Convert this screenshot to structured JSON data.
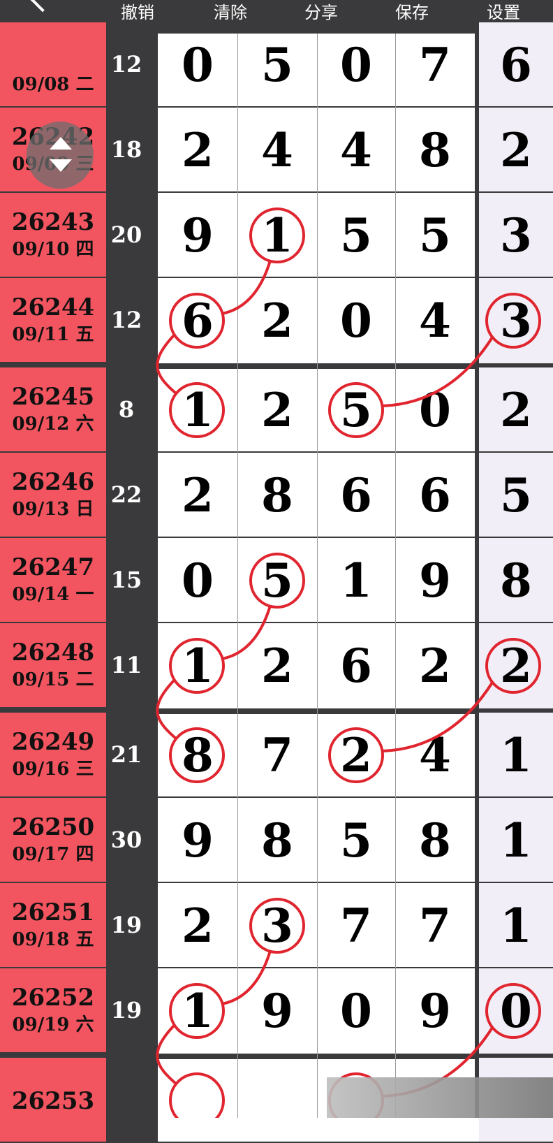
{
  "toolbar": {
    "undo": "撤销",
    "clear": "清除",
    "share": "分享",
    "save": "保存",
    "settings": "设置"
  },
  "colors": {
    "label_bg": "#f2555f",
    "dark": "#3a3a3c",
    "circle": "#e0252f",
    "last_col_bg": "#f2eef8"
  },
  "rows": [
    {
      "issue": "",
      "date": "09/08 二",
      "sum": "12",
      "digits": [
        "0",
        "5",
        "0",
        "7",
        "6"
      ],
      "circled": []
    },
    {
      "issue": "26242",
      "date": "09/09 三",
      "sum": "18",
      "digits": [
        "2",
        "4",
        "4",
        "8",
        "2"
      ],
      "circled": []
    },
    {
      "issue": "26243",
      "date": "09/10 四",
      "sum": "20",
      "digits": [
        "9",
        "1",
        "5",
        "5",
        "3"
      ],
      "circled": [
        1
      ]
    },
    {
      "issue": "26244",
      "date": "09/11 五",
      "sum": "12",
      "digits": [
        "6",
        "2",
        "0",
        "4",
        "3"
      ],
      "circled": [
        0,
        4
      ]
    },
    {
      "issue": "26245",
      "date": "09/12 六",
      "sum": "8",
      "digits": [
        "1",
        "2",
        "5",
        "0",
        "2"
      ],
      "circled": [
        0,
        2
      ]
    },
    {
      "issue": "26246",
      "date": "09/13 日",
      "sum": "22",
      "digits": [
        "2",
        "8",
        "6",
        "6",
        "5"
      ],
      "circled": []
    },
    {
      "issue": "26247",
      "date": "09/14 一",
      "sum": "15",
      "digits": [
        "0",
        "5",
        "1",
        "9",
        "8"
      ],
      "circled": [
        1
      ]
    },
    {
      "issue": "26248",
      "date": "09/15 二",
      "sum": "11",
      "digits": [
        "1",
        "2",
        "6",
        "2",
        "2"
      ],
      "circled": [
        0,
        4
      ]
    },
    {
      "issue": "26249",
      "date": "09/16 三",
      "sum": "21",
      "digits": [
        "8",
        "7",
        "2",
        "4",
        "1"
      ],
      "circled": [
        0,
        2
      ]
    },
    {
      "issue": "26250",
      "date": "09/17 四",
      "sum": "30",
      "digits": [
        "9",
        "8",
        "5",
        "8",
        "1"
      ],
      "circled": []
    },
    {
      "issue": "26251",
      "date": "09/18 五",
      "sum": "19",
      "digits": [
        "2",
        "3",
        "7",
        "7",
        "1"
      ],
      "circled": [
        1
      ]
    },
    {
      "issue": "26252",
      "date": "09/19 六",
      "sum": "19",
      "digits": [
        "1",
        "9",
        "0",
        "9",
        "0"
      ],
      "circled": [
        0,
        4
      ]
    },
    {
      "issue": "26253",
      "date": "",
      "sum": "",
      "digits": [
        "",
        "",
        "",
        "",
        ""
      ],
      "circled": [
        0,
        2
      ]
    }
  ]
}
